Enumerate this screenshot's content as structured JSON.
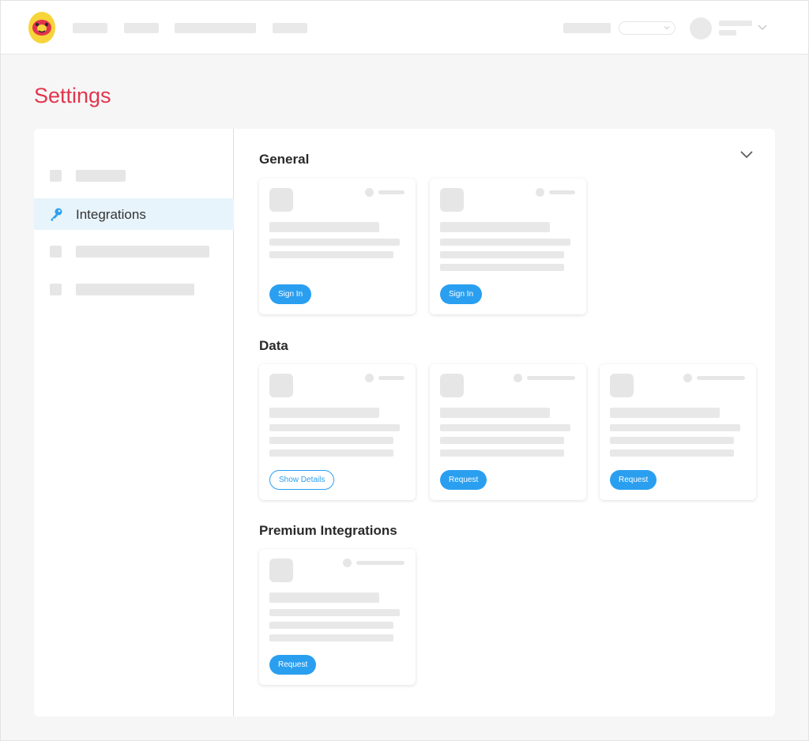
{
  "page": {
    "title": "Settings"
  },
  "sidebar": {
    "items": [
      {
        "label": "",
        "active": false
      },
      {
        "label": "Integrations",
        "active": true
      },
      {
        "label": "",
        "active": false
      },
      {
        "label": "",
        "active": false
      }
    ]
  },
  "sections": {
    "general": {
      "title": "General",
      "cards": [
        {
          "button_label": "Sign In"
        },
        {
          "button_label": "Sign In"
        }
      ]
    },
    "data": {
      "title": "Data",
      "cards": [
        {
          "button_label": "Show Details"
        },
        {
          "button_label": "Request"
        },
        {
          "button_label": "Request"
        }
      ]
    },
    "premium": {
      "title": "Premium Integrations",
      "cards": [
        {
          "button_label": "Request"
        }
      ]
    }
  },
  "icons": {
    "logo": "monkey-logo-icon",
    "integrations": "key-icon",
    "collapse": "chevron-down-icon",
    "user_menu": "chevron-down-icon"
  },
  "colors": {
    "title": "#e2344c",
    "accent": "#2a9ff0",
    "active_item_bg": "#e8f4fb",
    "logo_yellow": "#f7d43a",
    "logo_red": "#e2344c"
  }
}
